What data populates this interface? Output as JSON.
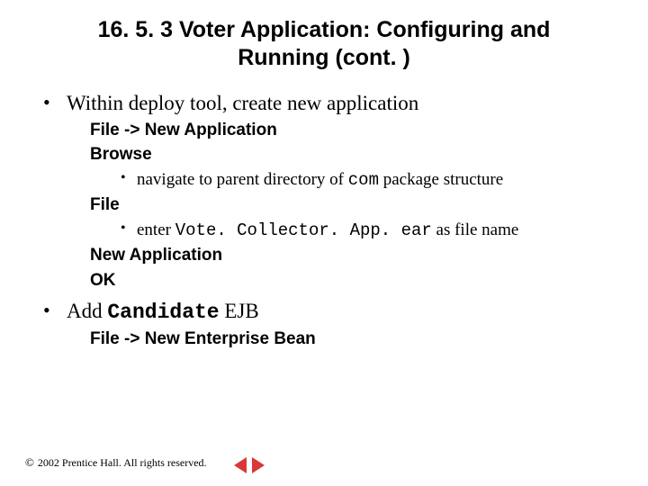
{
  "title_line1": "16. 5. 3   Voter Application: Configuring and",
  "title_line2": "Running (cont. )",
  "bullet1": "Within deploy tool, create new application",
  "sub_file_newapp": "File -> New Application",
  "sub_browse": "Browse",
  "sub_navigate_pre": "navigate to parent directory of ",
  "sub_navigate_mono": "com",
  "sub_navigate_post": " package structure",
  "sub_file": "File",
  "sub_enter_pre": "enter ",
  "sub_enter_mono": "Vote. Collector. App. ear",
  "sub_enter_post": " as file name",
  "sub_newapp": "New Application",
  "sub_ok": "OK",
  "bullet2_pre": "Add ",
  "bullet2_mono": "Candidate",
  "bullet2_post": " EJB",
  "sub_file_newbean": "File -> New Enterprise Bean",
  "copyright_symbol": "©",
  "copyright_text": " 2002 Prentice Hall. All rights reserved."
}
